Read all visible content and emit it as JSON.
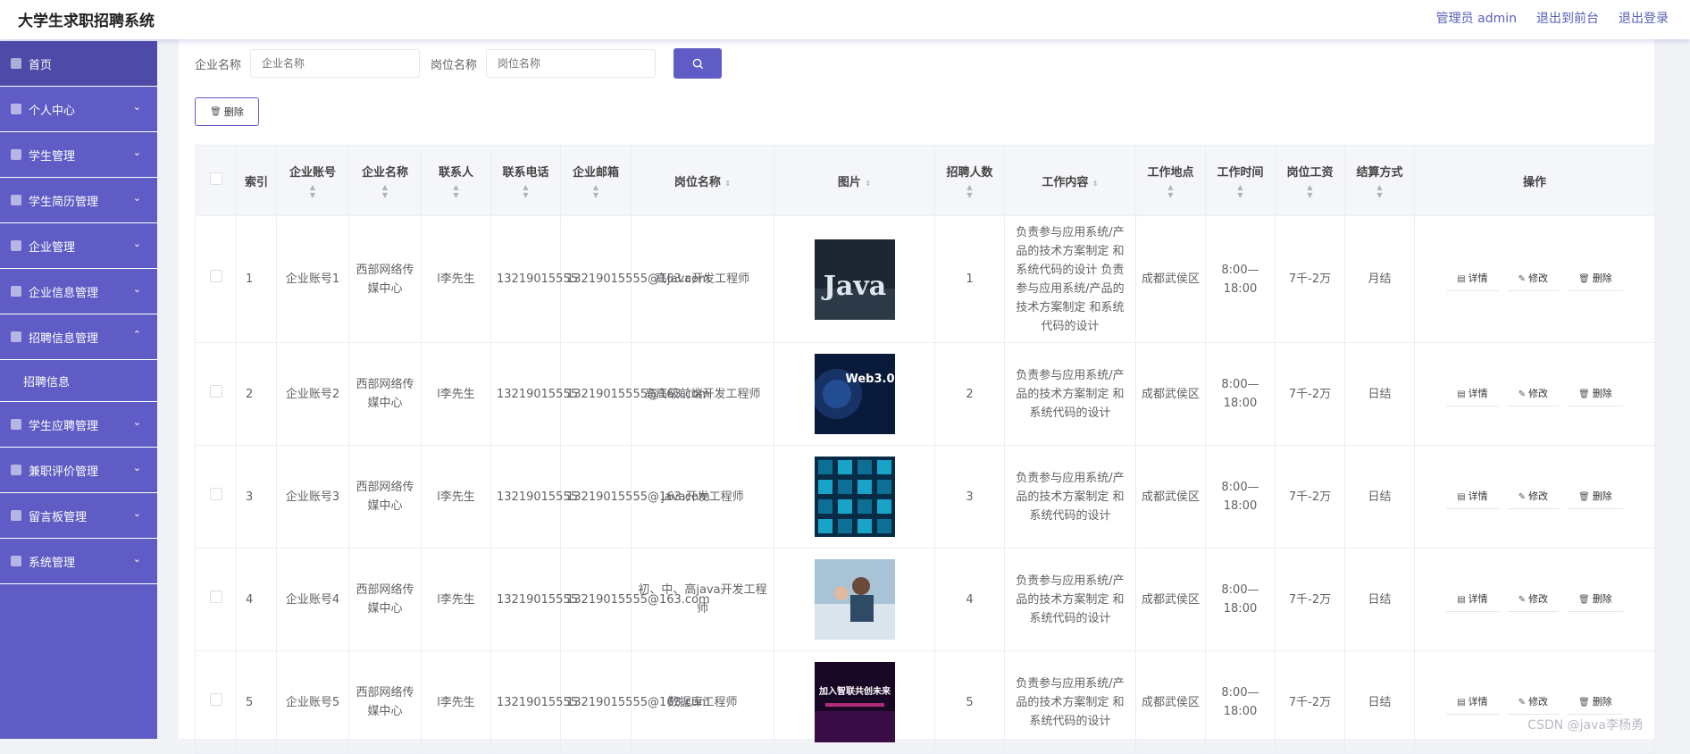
{
  "header": {
    "app_title": "大学生求职招聘系统",
    "user": "管理员 admin",
    "to_front": "退出到前台",
    "logout": "退出登录"
  },
  "sidebar": {
    "items": [
      {
        "label": "首页",
        "icon": "home-icon",
        "active": true
      },
      {
        "label": "个人中心",
        "icon": "user-icon"
      },
      {
        "label": "学生管理",
        "icon": "list-icon"
      },
      {
        "label": "学生简历管理",
        "icon": "clock-icon"
      },
      {
        "label": "企业管理",
        "icon": "doc-icon"
      },
      {
        "label": "企业信息管理",
        "icon": "scan-icon"
      },
      {
        "label": "招聘信息管理",
        "icon": "mic-icon",
        "expanded": true
      },
      {
        "label": "学生应聘管理",
        "icon": "chart-icon"
      },
      {
        "label": "兼职评价管理",
        "icon": "pin-icon"
      },
      {
        "label": "留言板管理",
        "icon": "clipboard-icon"
      },
      {
        "label": "系统管理",
        "icon": "compass-icon"
      }
    ],
    "submenu": {
      "label": "招聘信息"
    }
  },
  "search": {
    "company_label": "企业名称",
    "company_placeholder": "企业名称",
    "position_label": "岗位名称",
    "position_placeholder": "岗位名称"
  },
  "toolbar": {
    "delete_label": "删除"
  },
  "table": {
    "headers": [
      "索引",
      "企业账号",
      "企业名称",
      "联系人",
      "联系电话",
      "企业邮箱",
      "岗位名称",
      "图片",
      "招聘人数",
      "工作内容",
      "工作地点",
      "工作时间",
      "岗位工资",
      "结算方式",
      "操作"
    ],
    "actions": {
      "detail": "详情",
      "edit": "修改",
      "delete": "删除"
    },
    "rows": [
      {
        "index": "1",
        "account": "企业账号1",
        "company": "西部网络传媒中心",
        "contact": "l李先生",
        "phone": "13219015555",
        "email": "13219015555@163.com",
        "position": "高java开发工程师",
        "image": "java",
        "count": "1",
        "content": "负责参与应用系统/产品的技术方案制定 和系统代码的设计 负责参与应用系统/产品的技术方案制定 和系统代码的设计",
        "location": "成都武侯区",
        "time": "8:00—18:00",
        "salary": "7千-2万",
        "settlement": "月结"
      },
      {
        "index": "2",
        "account": "企业账号2",
        "company": "西部网络传媒中心",
        "contact": "l李先生",
        "phone": "13219015555",
        "email": "13219015555@163.com",
        "position": "高高级前端开发工程师",
        "image": "web3",
        "count": "2",
        "content": "负责参与应用系统/产品的技术方案制定 和系统代码的设计",
        "location": "成都武侯区",
        "time": "8:00—18:00",
        "salary": "7千-2万",
        "settlement": "日结"
      },
      {
        "index": "3",
        "account": "企业账号3",
        "company": "西部网络传媒中心",
        "contact": "l李先生",
        "phone": "13219015555",
        "email": "13219015555@163.com",
        "position": "java开发工程师",
        "image": "cubes",
        "count": "3",
        "content": "负责参与应用系统/产品的技术方案制定 和系统代码的设计",
        "location": "成都武侯区",
        "time": "8:00—18:00",
        "salary": "7千-2万",
        "settlement": "日结"
      },
      {
        "index": "4",
        "account": "企业账号4",
        "company": "西部网络传媒中心",
        "contact": "l李先生",
        "phone": "13219015555",
        "email": "13219015555@163.com",
        "position": "初、中、高java开发工程师",
        "image": "people",
        "count": "4",
        "content": "负责参与应用系统/产品的技术方案制定 和系统代码的设计",
        "location": "成都武侯区",
        "time": "8:00—18:00",
        "salary": "7千-2万",
        "settlement": "日结"
      },
      {
        "index": "5",
        "account": "企业账号5",
        "company": "西部网络传媒中心",
        "contact": "l李先生",
        "phone": "13219015555",
        "email": "13219015555@163.com",
        "position": "数据库工程师",
        "image": "poster",
        "count": "5",
        "content": "负责参与应用系统/产品的技术方案制定 和系统代码的设计",
        "location": "成都武侯区",
        "time": "8:00—18:00",
        "salary": "7千-2万",
        "settlement": "日结"
      }
    ]
  },
  "image_text": {
    "java": "Java",
    "web3": "Web3.0",
    "poster": "加入智联共创未来"
  },
  "watermark": "CSDN @java李杨勇"
}
